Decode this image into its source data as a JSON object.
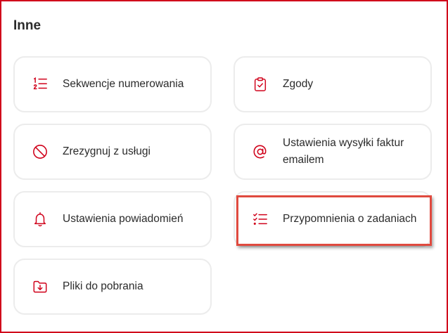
{
  "section": {
    "title": "Inne"
  },
  "tiles": [
    {
      "label": "Sekwencje numerowania",
      "icon": "numbered-list-icon"
    },
    {
      "label": "Zgody",
      "icon": "clipboard-check-icon"
    },
    {
      "label": "Zrezygnuj z usługi",
      "icon": "ban-icon"
    },
    {
      "label": "Ustawienia wysyłki faktur emailem",
      "icon": "at-sign-icon"
    },
    {
      "label": "Ustawienia powiadomień",
      "icon": "bell-icon"
    },
    {
      "label": "Przypomnienia o zadaniach",
      "icon": "checklist-icon",
      "highlighted": true
    },
    {
      "label": "Pliki do pobrania",
      "icon": "folder-download-icon"
    }
  ],
  "colors": {
    "accent": "#d0021b",
    "text": "#2b2b2b",
    "tile_border": "#ececec",
    "highlight": "#e04a3f"
  }
}
